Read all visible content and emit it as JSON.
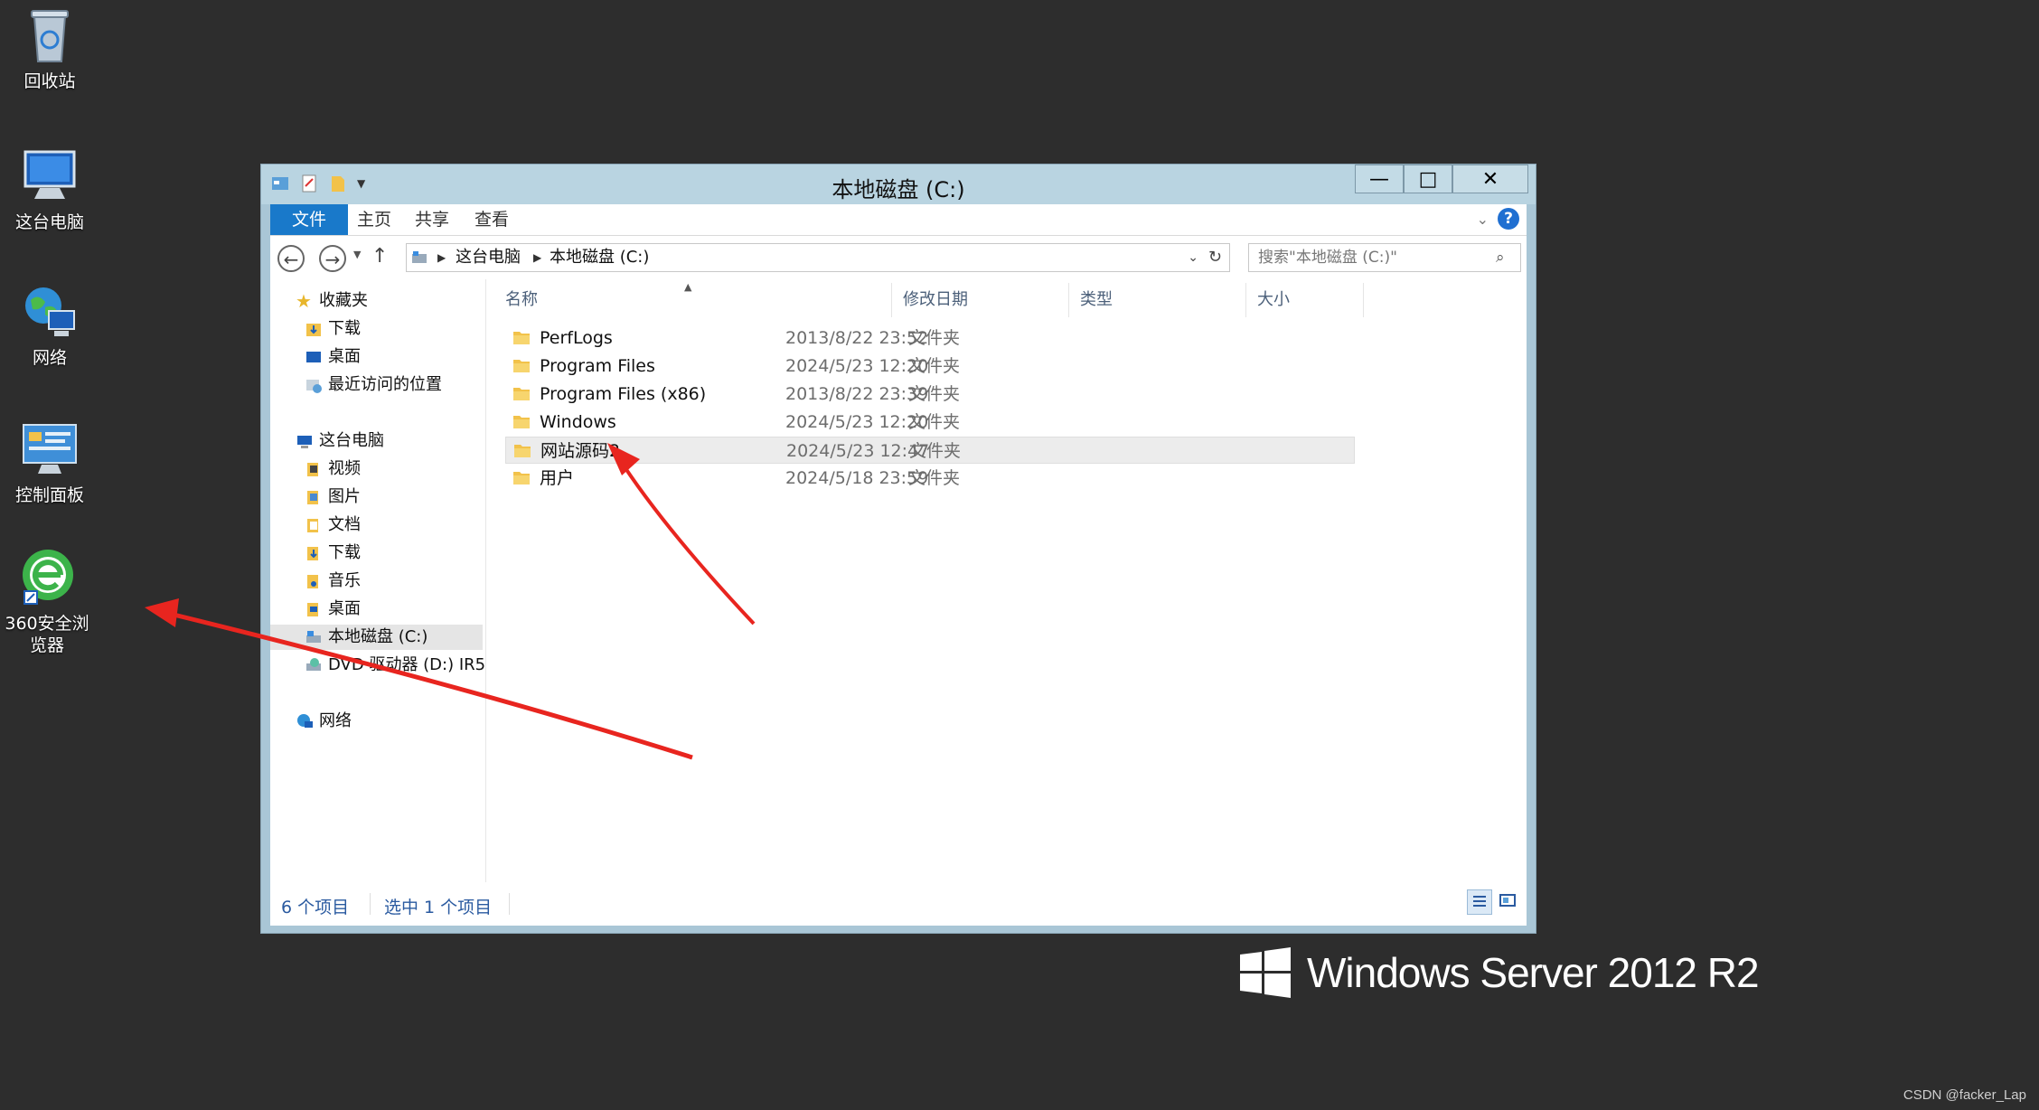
{
  "desktop": {
    "icons": [
      {
        "label": "回收站",
        "icon": "recycle-bin-icon"
      },
      {
        "label": "这台电脑",
        "icon": "computer-icon"
      },
      {
        "label": "网络",
        "icon": "network-icon"
      },
      {
        "label": "控制面板",
        "icon": "control-panel-icon"
      },
      {
        "label": "360安全浏览器",
        "icon": "browser-360-icon"
      }
    ]
  },
  "window": {
    "title": "本地磁盘 (C:)",
    "minimize": "—",
    "maximize": "□",
    "close": "✕"
  },
  "ribbon": {
    "tabs": [
      "文件",
      "主页",
      "共享",
      "查看"
    ],
    "help": "?"
  },
  "address": {
    "back": "←",
    "forward": "→",
    "up": "↑",
    "crumb1": "这台电脑",
    "crumb2": "本地磁盘 (C:)",
    "search_placeholder": "搜索\"本地磁盘 (C:)\""
  },
  "nav": {
    "favorites": "收藏夹",
    "fav_items": [
      "下载",
      "桌面",
      "最近访问的位置"
    ],
    "this_pc": "这台电脑",
    "pc_items": [
      "视频",
      "图片",
      "文档",
      "下载",
      "音乐",
      "桌面"
    ],
    "drive_c": "本地磁盘 (C:)",
    "drive_d": "DVD 驱动器 (D:) IR5",
    "network": "网络"
  },
  "list": {
    "columns": [
      "名称",
      "修改日期",
      "类型",
      "大小"
    ],
    "rows": [
      {
        "name": "PerfLogs",
        "date": "2013/8/22 23:52",
        "type": "文件夹"
      },
      {
        "name": "Program Files",
        "date": "2024/5/23 12:20",
        "type": "文件夹"
      },
      {
        "name": "Program Files (x86)",
        "date": "2013/8/22 23:39",
        "type": "文件夹"
      },
      {
        "name": "Windows",
        "date": "2024/5/23 12:20",
        "type": "文件夹"
      },
      {
        "name": "网站源码2",
        "date": "2024/5/23 12:47",
        "type": "文件夹"
      },
      {
        "name": "用户",
        "date": "2024/5/18 23:59",
        "type": "文件夹"
      }
    ]
  },
  "status": {
    "count": "6 个项目",
    "selected": "选中 1 个项目"
  },
  "brand": "Windows Server 2012 R2",
  "watermark": "CSDN @facker_Lap",
  "colors": {
    "desktop_bg": "#2d2d2d",
    "window_frame": "#a9c6d6",
    "file_tab": "#1979ca",
    "arrow": "#e8251f"
  }
}
